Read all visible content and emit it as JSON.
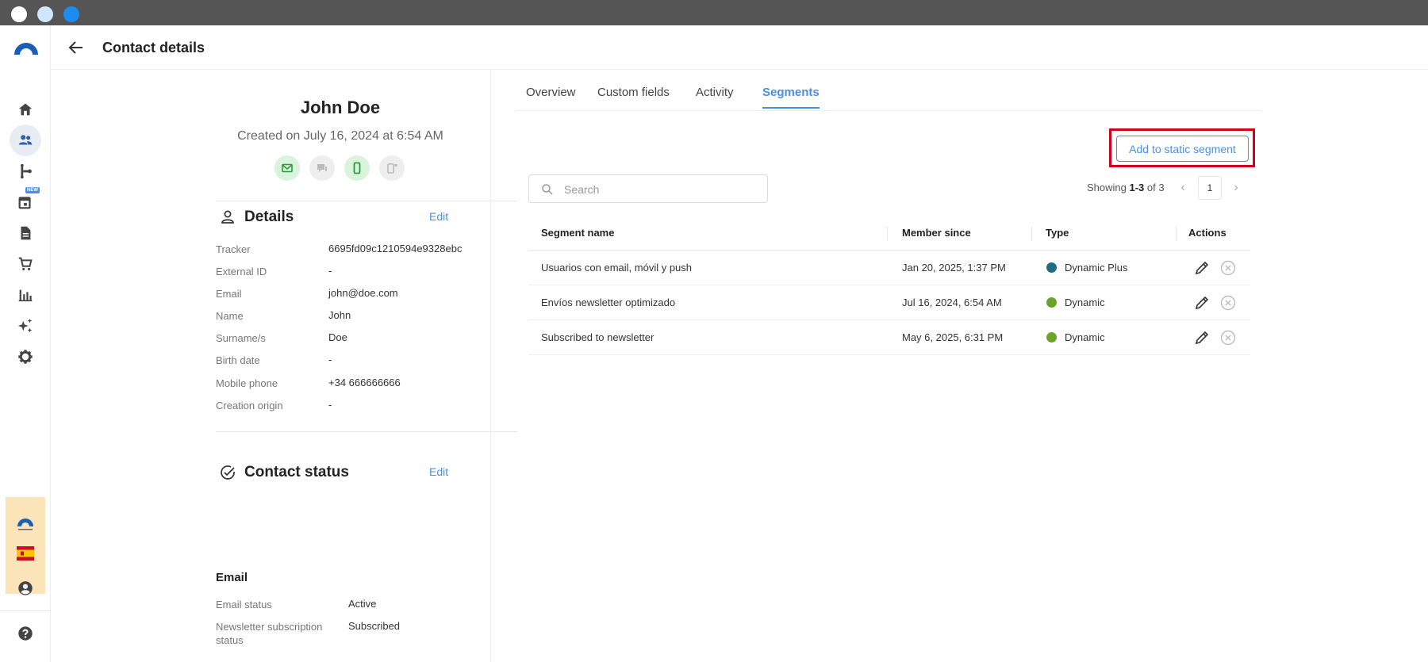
{
  "colors": {
    "accent": "#4a90e2",
    "dynamic_plus": "#1b6f85",
    "dynamic": "#6aa52a",
    "highlight": "#d0021b",
    "channel_on": "#daf3dc"
  },
  "header": {
    "title": "Contact details",
    "back_icon": "arrow-left-icon"
  },
  "sidebar": {
    "items": [
      {
        "name": "home",
        "icon": "home-icon"
      },
      {
        "name": "contacts",
        "icon": "contacts-icon",
        "active": true
      },
      {
        "name": "flows",
        "icon": "flow-icon"
      },
      {
        "name": "calendar",
        "icon": "calendar-icon",
        "badge": "NEW"
      },
      {
        "name": "templates",
        "icon": "document-icon"
      },
      {
        "name": "ecommerce",
        "icon": "cart-icon"
      },
      {
        "name": "reports",
        "icon": "bar-chart-icon"
      },
      {
        "name": "ai",
        "icon": "sparkles-icon"
      },
      {
        "name": "settings",
        "icon": "gear-icon"
      }
    ],
    "bottom": [
      "brand-icon",
      "spain-flag-icon",
      "user-account-icon",
      "help-icon"
    ]
  },
  "contact": {
    "name": "John Doe",
    "created": "Created on July 16, 2024 at 6:54 AM",
    "channels": [
      {
        "icon": "email-icon",
        "enabled": true
      },
      {
        "icon": "chat-icon",
        "enabled": false
      },
      {
        "icon": "mobile-icon",
        "enabled": true
      },
      {
        "icon": "push-icon",
        "enabled": false
      }
    ]
  },
  "details": {
    "title": "Details",
    "edit_label": "Edit",
    "fields": [
      {
        "label": "Tracker",
        "value": "6695fd09c1210594e9328ebc"
      },
      {
        "label": "External ID",
        "value": "-"
      },
      {
        "label": "Email",
        "value": "john@doe.com"
      },
      {
        "label": "Name",
        "value": "John"
      },
      {
        "label": "Surname/s",
        "value": "Doe"
      },
      {
        "label": "Birth date",
        "value": "-"
      },
      {
        "label": "Mobile phone",
        "value": "+34 666666666"
      },
      {
        "label": "Creation origin",
        "value": "-"
      }
    ]
  },
  "contact_status": {
    "title": "Contact status",
    "edit_label": "Edit",
    "subheading": "Email",
    "fields": [
      {
        "label": "Email status",
        "value": "Active"
      },
      {
        "label": "Newsletter subscription status",
        "value": "Subscribed"
      }
    ]
  },
  "tabs": [
    "Overview",
    "Custom fields",
    "Activity",
    "Segments"
  ],
  "active_tab": "Segments",
  "segments": {
    "add_button": "Add to static segment",
    "search_placeholder": "Search",
    "showing_prefix": "Showing ",
    "showing_range": "1-3",
    "showing_suffix": " of 3",
    "page": "1",
    "columns": [
      "Segment name",
      "Member since",
      "Type",
      "Actions"
    ],
    "rows": [
      {
        "name": "Usuarios con email, móvil y push",
        "since": "Jan 20, 2025, 1:37 PM",
        "type": "Dynamic Plus",
        "type_color": "#1b6f85"
      },
      {
        "name": "Envíos newsletter optimizado",
        "since": "Jul 16, 2024, 6:54 AM",
        "type": "Dynamic",
        "type_color": "#6aa52a"
      },
      {
        "name": "Subscribed to newsletter",
        "since": "May 6, 2025, 6:31 PM",
        "type": "Dynamic",
        "type_color": "#6aa52a"
      }
    ]
  }
}
